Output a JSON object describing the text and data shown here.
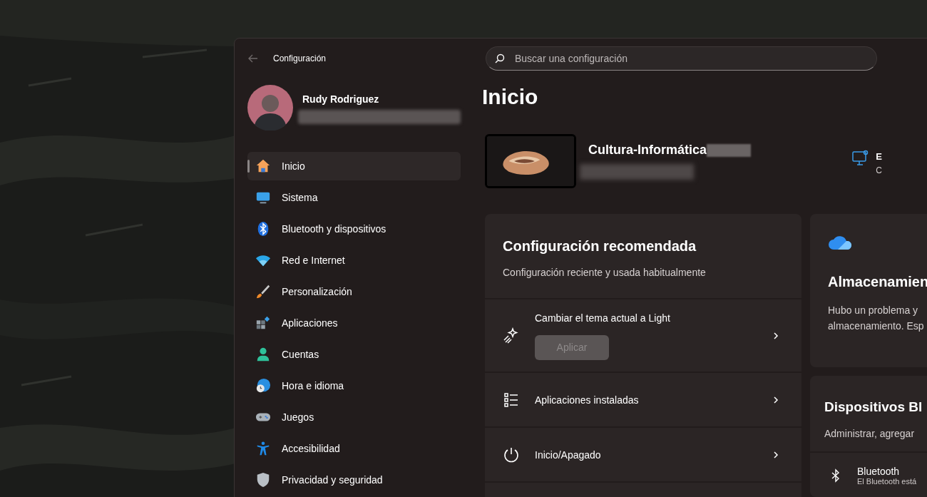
{
  "window": {
    "title": "Configuración"
  },
  "search": {
    "placeholder": "Buscar una configuración"
  },
  "profile": {
    "name": "Rudy Rodriguez"
  },
  "sidebar": {
    "items": [
      {
        "label": "Inicio",
        "selected": true
      },
      {
        "label": "Sistema",
        "selected": false
      },
      {
        "label": "Bluetooth y dispositivos",
        "selected": false
      },
      {
        "label": "Red e Internet",
        "selected": false
      },
      {
        "label": "Personalización",
        "selected": false
      },
      {
        "label": "Aplicaciones",
        "selected": false
      },
      {
        "label": "Cuentas",
        "selected": false
      },
      {
        "label": "Hora e idioma",
        "selected": false
      },
      {
        "label": "Juegos",
        "selected": false
      },
      {
        "label": "Accesibilidad",
        "selected": false
      },
      {
        "label": "Privacidad y seguridad",
        "selected": false
      }
    ]
  },
  "page": {
    "title": "Inicio"
  },
  "device": {
    "name": "Cultura-Informática"
  },
  "status": {
    "title": "E",
    "subtitle": "C"
  },
  "recommended": {
    "title": "Configuración recomendada",
    "subtitle": "Configuración reciente y usada habitualmente",
    "rows": [
      {
        "kind": "action",
        "label": "Cambiar el tema actual a Light",
        "button": {
          "label": "Aplicar",
          "disabled": true
        }
      },
      {
        "kind": "link",
        "label": "Aplicaciones instaladas"
      },
      {
        "kind": "link",
        "label": "Inicio/Apagado"
      }
    ]
  },
  "storage_card": {
    "title": "Almacenamien",
    "lines": [
      "Hubo un problema y",
      "almacenamiento. Esp"
    ]
  },
  "bluetooth_card": {
    "title": "Dispositivos Bl",
    "subtitle": "Administrar, agregar",
    "row": {
      "label": "Bluetooth",
      "detail": "El Bluetooth está"
    }
  }
}
